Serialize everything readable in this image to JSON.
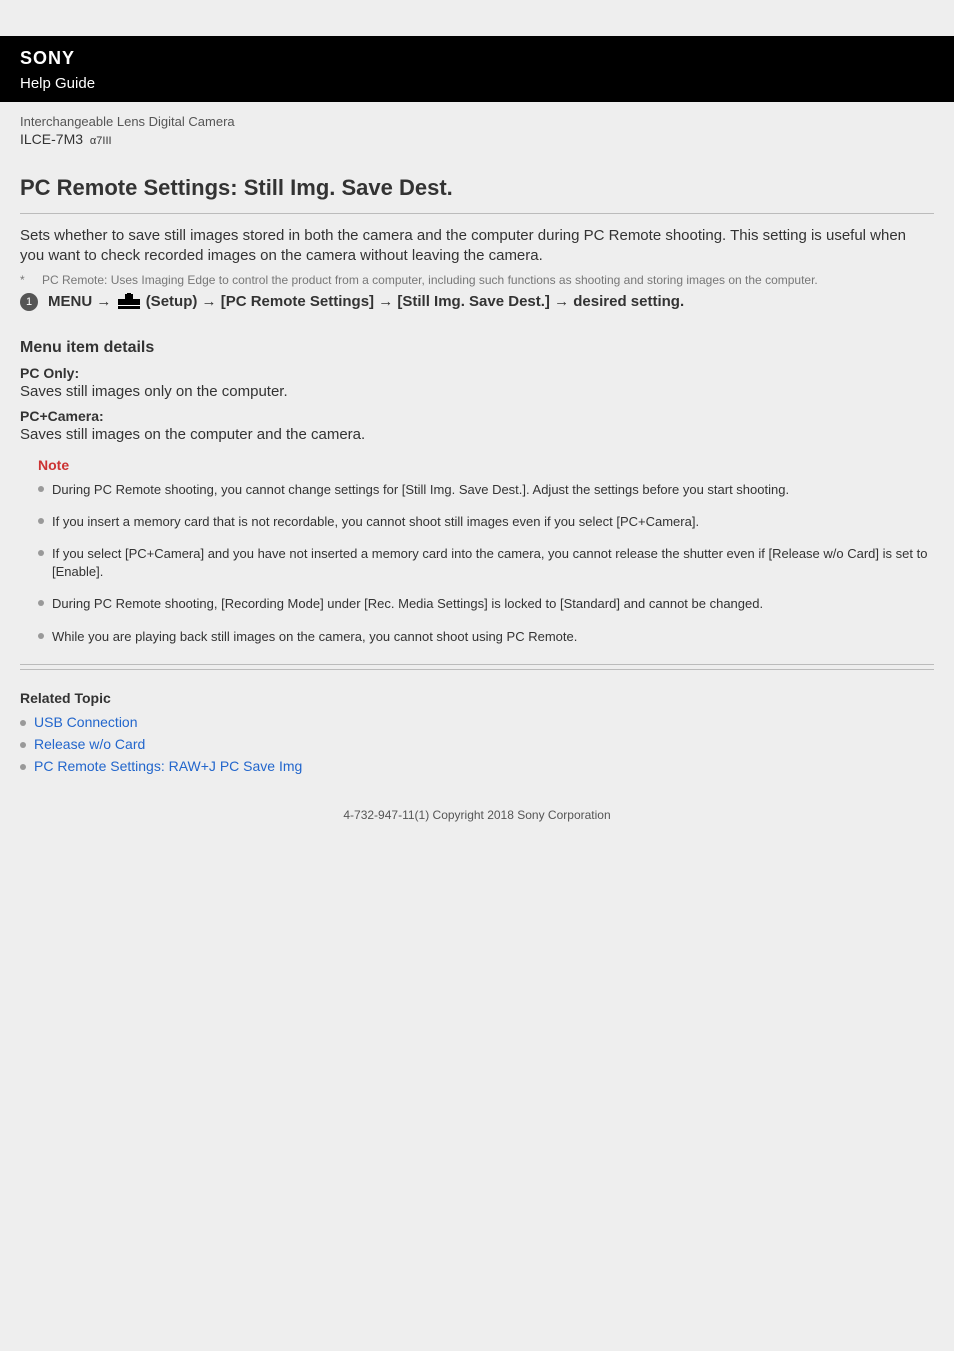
{
  "header": {
    "brand": "SONY",
    "guide": "Help Guide"
  },
  "product": {
    "label": "Interchangeable Lens Digital Camera",
    "model": "ILCE-7M3",
    "model_sub": "α7III"
  },
  "page_title": "PC Remote Settings: Still Img. Save Dest.",
  "intro": "Sets whether to save still images stored in both the camera and the computer during PC Remote shooting. This setting is useful when you want to check recorded images on the camera without leaving the camera.",
  "footnote": {
    "mark": "*",
    "text": "PC Remote: Uses Imaging Edge to control the product from a computer, including such functions as shooting and storing images on the computer."
  },
  "step": {
    "num": "1",
    "menu": "MENU",
    "arrow": "→",
    "setup": "(Setup)",
    "path_rest": "[PC Remote Settings] → [Still Img. Save Dest.] → desired setting."
  },
  "details": {
    "heading": "Menu item details",
    "items": [
      {
        "label": "PC Only:",
        "desc": "Saves still images only on the computer."
      },
      {
        "label": "PC+Camera:",
        "desc": "Saves still images on the computer and the camera."
      }
    ]
  },
  "note": {
    "title": "Note",
    "items": [
      "During PC Remote shooting, you cannot change settings for [Still Img. Save Dest.]. Adjust the settings before you start shooting.",
      "If you insert a memory card that is not recordable, you cannot shoot still images even if you select [PC+Camera].",
      "If you select [PC+Camera] and you have not inserted a memory card into the camera, you cannot release the shutter even if [Release w/o Card] is set to [Enable].",
      "During PC Remote shooting, [Recording Mode] under [Rec. Media Settings] is locked to [Standard] and cannot be changed.",
      "While you are playing back still images on the camera, you cannot shoot using PC Remote."
    ]
  },
  "related": {
    "heading": "Related Topic",
    "links": [
      "USB Connection",
      "Release w/o Card",
      "PC Remote Settings: RAW+J PC Save Img"
    ]
  },
  "copyright": "4-732-947-11(1) Copyright 2018 Sony Corporation"
}
